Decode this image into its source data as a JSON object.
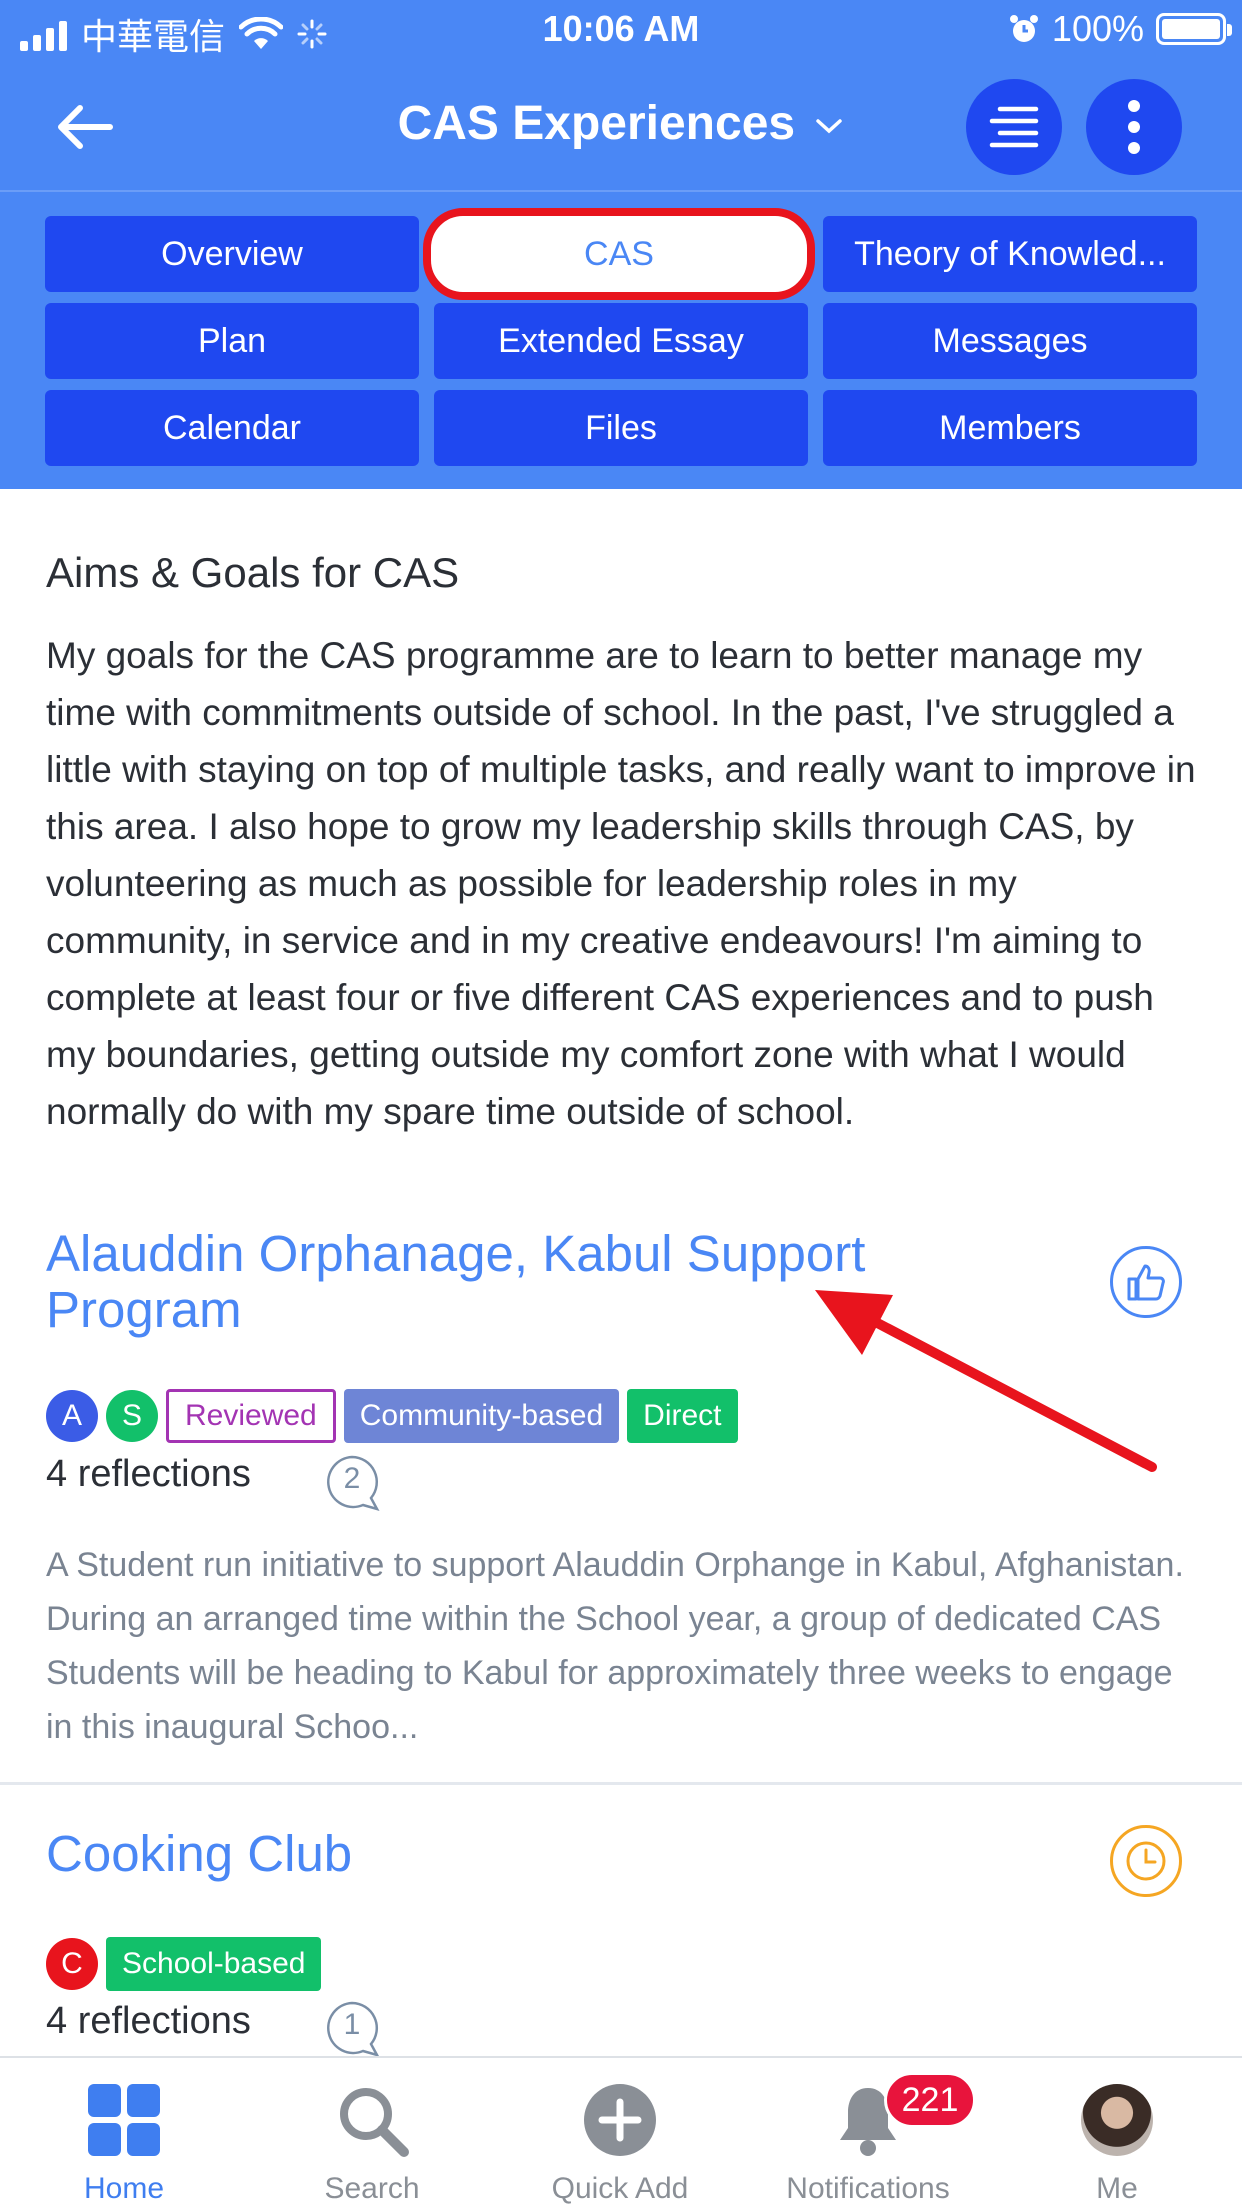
{
  "status_bar": {
    "carrier": "中華電信",
    "time": "10:06 AM",
    "battery": "100%"
  },
  "header": {
    "title": "CAS Experiences",
    "icons": [
      "back-arrow-icon",
      "chevron-down-icon",
      "menu-lines-icon",
      "more-vertical-icon"
    ]
  },
  "tabs": [
    {
      "label": "Overview"
    },
    {
      "label": "CAS",
      "active": true
    },
    {
      "label": "Theory of Knowled..."
    },
    {
      "label": "Plan"
    },
    {
      "label": "Extended Essay"
    },
    {
      "label": "Messages"
    },
    {
      "label": "Calendar"
    },
    {
      "label": "Files"
    },
    {
      "label": "Members"
    }
  ],
  "aims": {
    "title": "Aims & Goals for CAS",
    "text": "My goals for the CAS programme are to learn to better manage my time with commitments outside of school. In the past, I've struggled a little with staying on top of multiple tasks, and really want to improve in this area. I also hope to grow my leadership skills through CAS, by volunteering as much as possible for leadership roles in my community, in service and in my creative endeavours! I'm aiming to complete at least four or five different CAS experiences and to push my boundaries, getting outside my comfort zone with what I would normally do with my spare time outside of school."
  },
  "experiences": [
    {
      "title": "Alauddin Orphanage, Kabul Support Program",
      "status_icon": "thumbs-up-icon",
      "avatars": [
        "A",
        "S"
      ],
      "tags": [
        "Reviewed",
        "Community-based",
        "Direct"
      ],
      "reflections": "4 reflections",
      "comments": "2",
      "description": "A Student run initiative to support Alauddin Orphange in Kabul, Afghanistan. During an arranged time within the School year, a group of dedicated CAS Students will be heading to Kabul for approximately three weeks to engage in this inaugural Schoo..."
    },
    {
      "title": "Cooking Club",
      "status_icon": "clock-icon",
      "avatars": [
        "C"
      ],
      "tags": [
        "School-based"
      ],
      "reflections": "4 reflections",
      "comments": "1"
    }
  ],
  "tab_bar": {
    "items": [
      {
        "label": "Home",
        "icon": "grid-icon",
        "active": true
      },
      {
        "label": "Search",
        "icon": "search-icon"
      },
      {
        "label": "Quick Add",
        "icon": "plus-circle-icon"
      },
      {
        "label": "Notifications",
        "icon": "bell-icon"
      },
      {
        "label": "Me",
        "icon": "profile-avatar"
      }
    ],
    "notification_count": "221"
  },
  "colors": {
    "primary": "#4a87f5",
    "tab_bg": "#1f48f0",
    "highlight_red": "#e8141d",
    "tag_green": "#12c06a",
    "tag_purple": "#6e85d6",
    "reviewed_purple": "#a334b3",
    "clock_orange": "#f5a623"
  }
}
